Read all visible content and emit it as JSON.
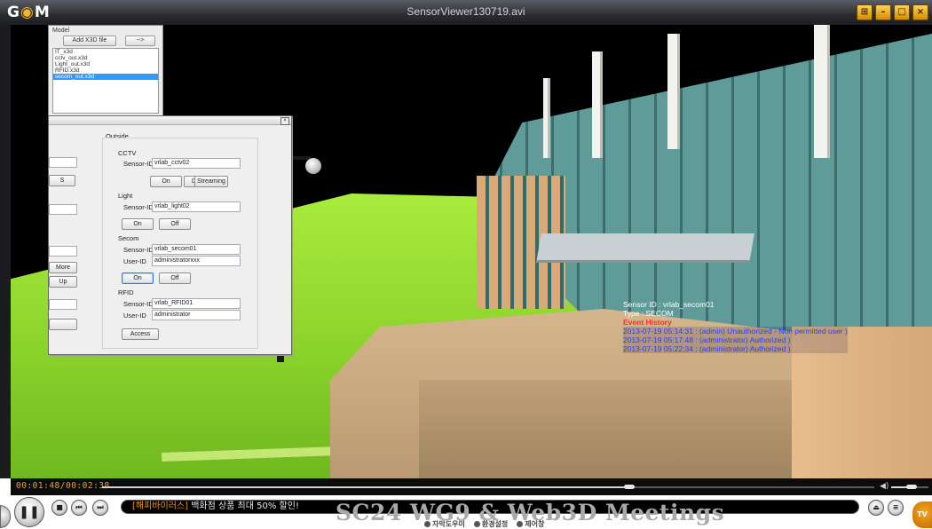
{
  "window": {
    "app_logo": "GOM",
    "title": "SensorViewer130719.avi",
    "buttons": [
      "settings",
      "minimize",
      "maximize",
      "close"
    ]
  },
  "model_panel": {
    "title": "Model",
    "add_button": "Add X3D file",
    "arrow_button": "-->",
    "files": [
      "IT_x3d",
      "cctv_out.x3d",
      "Light_out.x3d",
      "RFID.x3d",
      "secom_out.x3d"
    ],
    "selected_file": "secom_out.x3d"
  },
  "dialog": {
    "left_buttons": [
      "S",
      "More",
      "Up"
    ],
    "outside_label": "Outside",
    "cctv": {
      "label": "CCTV",
      "sensor_id_label": "Sensor-ID",
      "sensor_id_value": "vrlab_cctv02",
      "buttons": [
        "On",
        "Down",
        "Streaming"
      ]
    },
    "light": {
      "label": "Light",
      "sensor_id_label": "Sensor-ID",
      "sensor_id_value": "vrlab_light02",
      "buttons": [
        "On",
        "Off"
      ]
    },
    "secom": {
      "label": "Secom",
      "sensor_id_label": "Sensor-ID",
      "sensor_id_value": "vrlab_secom01",
      "user_id_label": "User-ID",
      "user_id_value": "administratorxxx",
      "buttons": [
        "On",
        "Off"
      ]
    },
    "rfid": {
      "label": "RFID",
      "sensor_id_label": "Sensor-ID",
      "sensor_id_value": "vrlab_RFID01",
      "user_id_label": "User-ID",
      "user_id_value": "administrator",
      "buttons": [
        "Access"
      ]
    }
  },
  "scene_overlay": {
    "sensor_line": "Sensor ID : vrlab_secom01",
    "type_line": "Type : SECOM",
    "history_label": "Event History",
    "events": [
      "2013-07-19 05:14:31 : (admin) Unauthorized - Non permitted user )",
      "2013-07-19 05:17:48 : (administrator) Authorized )",
      "2013-07-19 05:22:34 : (administrator) Authorized )"
    ]
  },
  "controls": {
    "timecode": "00:01:48/00:02:38",
    "progress_fraction": 0.683,
    "volume_fraction": 0.55,
    "ticker_tag": "[해피바이러스]",
    "ticker_message": "백화점 상품 최대 50% 할인!",
    "watermark": "SC24 WG9 & Web3D Meetings",
    "menu": [
      "자막도우미",
      "환경설정",
      "제어창"
    ],
    "brand": "GOM TV"
  },
  "colors": {
    "accent": "#f0a020",
    "titlebar": "#2b2d31",
    "grass": "#8bd22b",
    "building_glass": "#5f9c99",
    "overlay_red": "#ff2b2b",
    "overlay_blue": "#2a3bff"
  }
}
